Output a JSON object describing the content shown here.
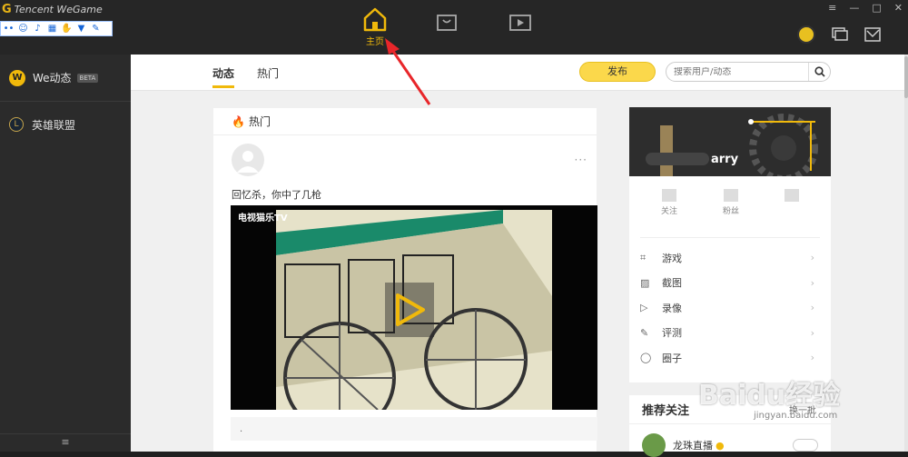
{
  "app": {
    "brand_text": "Tencent WeGame"
  },
  "topnav": {
    "home_label": "主页"
  },
  "sidebar": {
    "items": [
      {
        "label": "We动态",
        "badge": "BETA",
        "icon": "wegame-logo"
      },
      {
        "label": "英雄联盟",
        "icon": "lol-logo"
      }
    ],
    "bottom_icon": "≡"
  },
  "tabs": [
    {
      "label": "动态"
    },
    {
      "label": "热门"
    }
  ],
  "toolbar": {
    "publish_label": "发布",
    "search_placeholder": "搜索用户/动态"
  },
  "feed": {
    "header": "热门",
    "post": {
      "text": "回忆杀，你中了几枪",
      "more": "···",
      "caption": "."
    },
    "video": {
      "channel_logo": "电视猫乐TV"
    }
  },
  "profile": {
    "username": "arry",
    "stats": [
      {
        "label": "关注"
      },
      {
        "label": "粉丝"
      },
      {
        "label": ""
      }
    ],
    "menu": [
      {
        "label": "游戏",
        "icon": "game-icon"
      },
      {
        "label": "截图",
        "icon": "screenshot-icon"
      },
      {
        "label": "录像",
        "icon": "video-icon"
      },
      {
        "label": "评测",
        "icon": "review-icon"
      },
      {
        "label": "圈子",
        "icon": "circle-icon"
      }
    ]
  },
  "recommend": {
    "title": "推荐关注",
    "swap_label": "换一批",
    "items": [
      {
        "name": "龙珠直播"
      }
    ]
  },
  "watermark": {
    "text": "Baidu经验",
    "sub": "jingyan.baidu.com"
  },
  "colors": {
    "accent": "#f0b90b",
    "topbar": "#262626",
    "sidebar": "#2b2b2b",
    "annotation_arrow": "#e8262a"
  }
}
